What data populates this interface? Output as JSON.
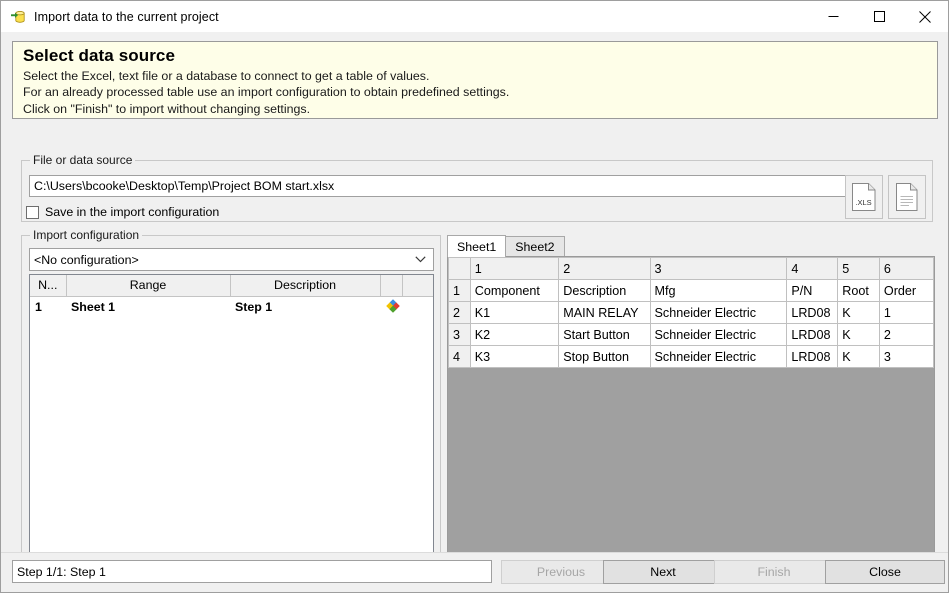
{
  "window": {
    "title": "Import data to the current project",
    "icon": "import-database-icon",
    "controls": {
      "minimize": "minimize-icon",
      "maximize": "maximize-icon",
      "close": "close-icon"
    }
  },
  "banner": {
    "heading": "Select data source",
    "line1": "Select the Excel, text file or a database to connect to get a table of values.",
    "line2": "For an already processed table use an import configuration to obtain predefined settings.",
    "line3": "Click on \"Finish\" to import without changing settings.",
    "background": "#fefee8"
  },
  "file_group": {
    "legend": "File or data source",
    "path_value": "C:\\Users\\bcooke\\Desktop\\Temp\\Project BOM start.xlsx",
    "path_placeholder": "",
    "xls_button_label": ".XLS",
    "xls_button_icon": "excel-document-icon",
    "file_button_icon": "text-document-icon",
    "checkbox_label": "Save in the import configuration",
    "checkbox_checked": false
  },
  "import_group": {
    "legend": "Import configuration",
    "combo_value": "<No configuration>",
    "combo_arrow_icon": "chevron-down-icon",
    "columns": [
      "N...",
      "Range",
      "Description",
      "",
      ""
    ],
    "rows": [
      {
        "n": "1",
        "range": "Sheet 1",
        "description": "Step 1",
        "icon": "colored-diamond-icon"
      }
    ]
  },
  "preview": {
    "tabs": [
      {
        "label": "Sheet1",
        "active": true
      },
      {
        "label": "Sheet2",
        "active": false
      }
    ],
    "column_headers": [
      "",
      "1",
      "2",
      "3",
      "4",
      "5",
      "6"
    ],
    "rows": [
      {
        "header": "1",
        "cells": [
          "Component",
          "Description",
          "Mfg",
          "P/N",
          "Root",
          "Order"
        ]
      },
      {
        "header": "2",
        "cells": [
          "K1",
          "MAIN RELAY",
          "Schneider Electric",
          "LRD08",
          "K",
          "1"
        ]
      },
      {
        "header": "3",
        "cells": [
          "K2",
          "Start Button",
          "Schneider Electric",
          "LRD08",
          "K",
          "2"
        ]
      },
      {
        "header": "4",
        "cells": [
          "K3",
          "Stop Button",
          "Schneider Electric",
          "LRD08",
          "K",
          "3"
        ]
      }
    ],
    "empty_background": "#a0a0a0"
  },
  "footer": {
    "status_value": "Step 1/1: Step 1",
    "buttons": [
      {
        "label": "Previous",
        "enabled": false
      },
      {
        "label": "Next",
        "enabled": true
      },
      {
        "label": "Finish",
        "enabled": false
      },
      {
        "label": "Close",
        "enabled": true
      }
    ]
  }
}
